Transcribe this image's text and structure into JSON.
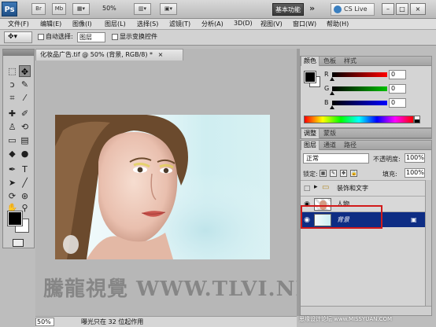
{
  "appbar": {
    "logo": "Ps",
    "buttons": [
      "Br",
      "Mb"
    ],
    "zoom": "50%",
    "workspace": "基本功能",
    "cs_live": "CS Live",
    "window_controls": [
      "–",
      "□",
      "×"
    ]
  },
  "menu": [
    "文件(F)",
    "编辑(E)",
    "图像(I)",
    "图层(L)",
    "选择(S)",
    "滤镜(T)",
    "分析(A)",
    "3D(D)",
    "视图(V)",
    "窗口(W)",
    "帮助(H)"
  ],
  "options": {
    "auto_select_label": "自动选择:",
    "auto_select_value": "图层",
    "show_transform_label": "显示变换控件"
  },
  "document": {
    "tab_title": "化妆品广告.tif @ 50% (背景, RGB/8) *",
    "close": "×"
  },
  "status": {
    "zoom": "50%",
    "text": "曝光只在 32 位起作用"
  },
  "watermark": "騰龍視覺 WWW.TLVI.NET",
  "color_panel": {
    "tabs": [
      "颜色",
      "色板",
      "样式"
    ],
    "channels": [
      {
        "label": "R",
        "value": "0",
        "color": "#ff0000"
      },
      {
        "label": "G",
        "value": "0",
        "color": "#00aa00"
      },
      {
        "label": "B",
        "value": "0",
        "color": "#0000ff"
      }
    ]
  },
  "adjust_panel": {
    "tabs": [
      "调整",
      "蒙版"
    ]
  },
  "layers_panel": {
    "tabs": [
      "图层",
      "通道",
      "路径"
    ],
    "blend_mode": "正常",
    "opacity_label": "不透明度:",
    "opacity_value": "100%",
    "lock_label": "锁定:",
    "fill_label": "填充:",
    "fill_value": "100%",
    "layers": [
      {
        "name": "装饰和文字",
        "kind": "group"
      },
      {
        "name": "人物",
        "kind": "image"
      },
      {
        "name": "背景",
        "kind": "background",
        "selected": true
      }
    ]
  },
  "site_mark": "思缘设计论坛 www.MISSYUAN.COM"
}
